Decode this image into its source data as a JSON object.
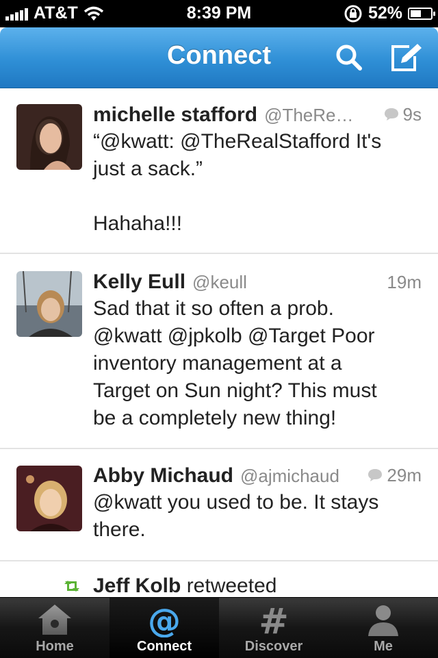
{
  "status": {
    "carrier": "AT&T",
    "time": "8:39 PM",
    "battery": "52%",
    "battery_level": 0.52
  },
  "nav": {
    "title": "Connect",
    "icons": [
      "search-icon",
      "compose-icon"
    ]
  },
  "tweets": [
    {
      "name": "michelle stafford",
      "handle": "@TheRe…",
      "time": "9s",
      "has_reply_icon": true,
      "text": "“@kwatt: @TheRealStafford It's\njust a sack.”\n\nHahaha!!!"
    },
    {
      "name": "Kelly Eull",
      "handle": "@keull",
      "time": "19m",
      "has_reply_icon": false,
      "text": "Sad that it so often a prob.\n@kwatt @jpkolb @Target Poor\ninventory management at a\nTarget on Sun night? This must\nbe a completely new thing!"
    },
    {
      "name": "Abby Michaud",
      "handle": "@ajmichaud",
      "time": "29m",
      "has_reply_icon": true,
      "text": "@kwatt you used to be. It stays\nthere."
    }
  ],
  "retweet": {
    "user": "Jeff Kolb",
    "action": "retweeted"
  },
  "tabs": [
    {
      "label": "Home",
      "icon": "home-icon",
      "active": false
    },
    {
      "label": "Connect",
      "icon": "at-icon",
      "active": true
    },
    {
      "label": "Discover",
      "icon": "hash-icon",
      "active": false
    },
    {
      "label": "Me",
      "icon": "person-icon",
      "active": false
    }
  ],
  "colors": {
    "nav_blue": "#2f8fd6",
    "retweet_green": "#5bb334",
    "tab_active_icon": "#4aa8ec"
  }
}
